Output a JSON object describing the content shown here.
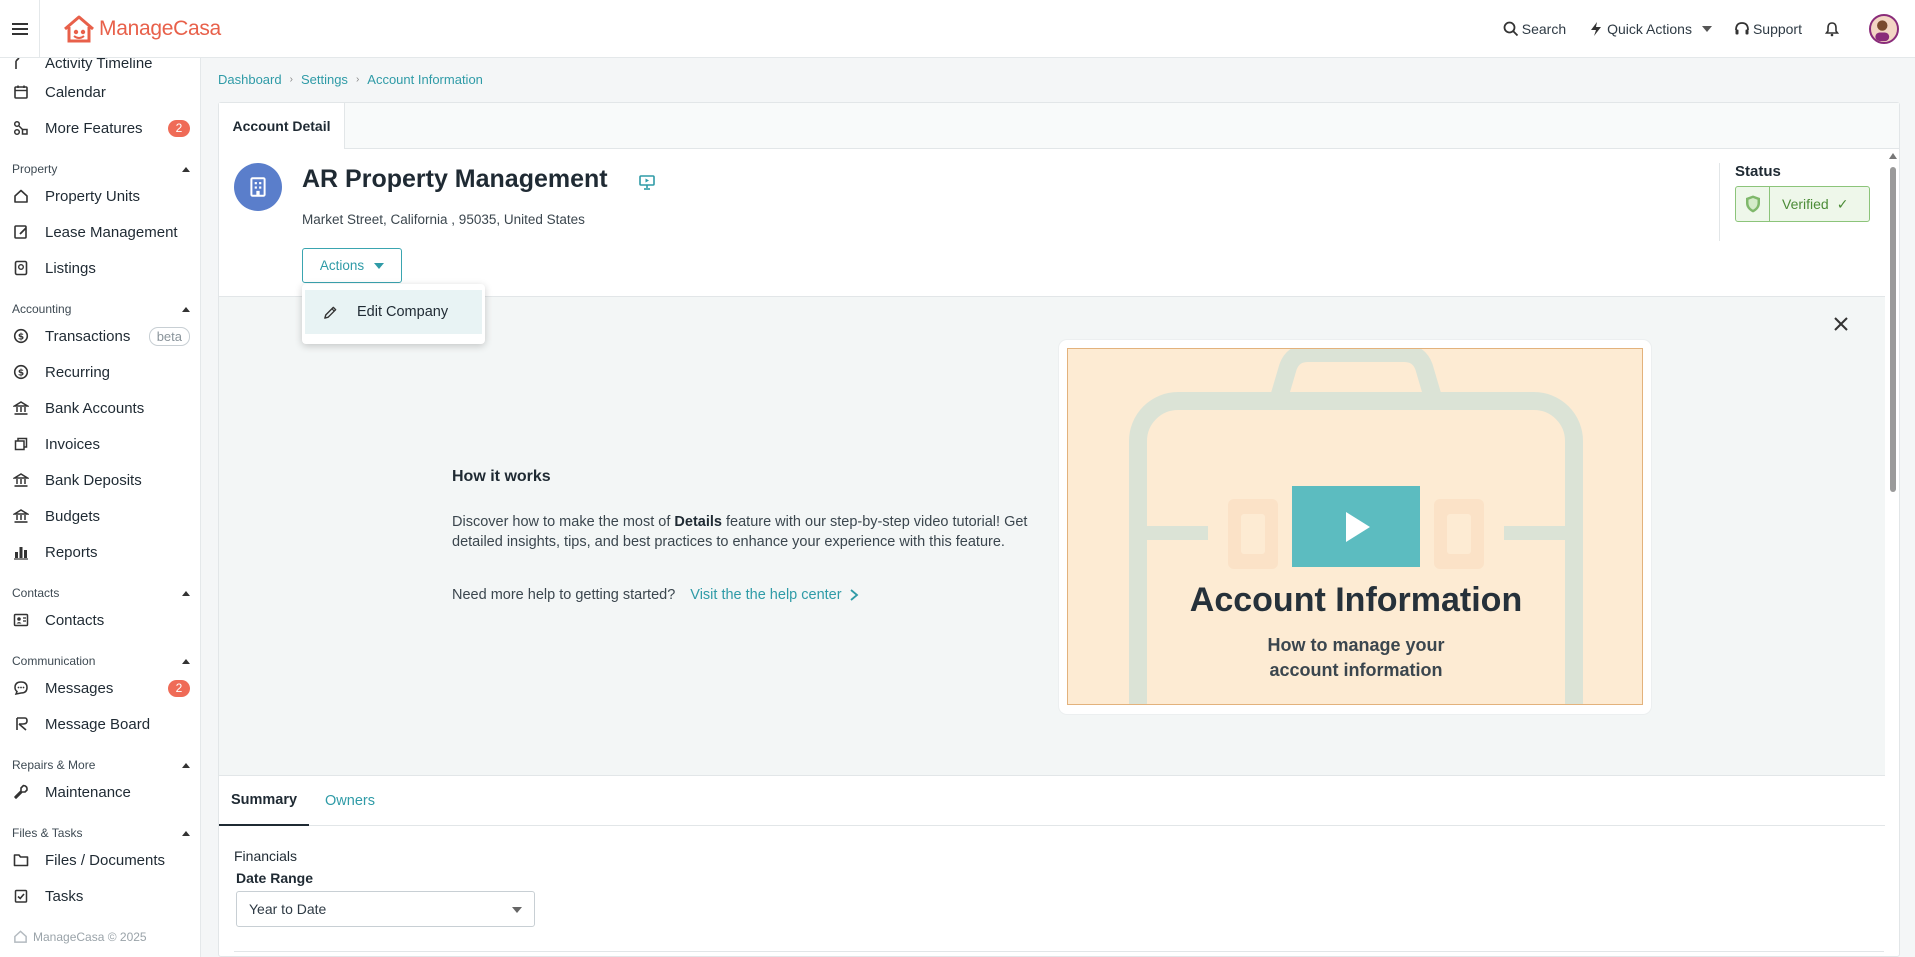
{
  "app": {
    "logo_manage": "Manage",
    "logo_casa": "Casa"
  },
  "topbar": {
    "search_label": "Search",
    "quick_actions_label": "Quick Actions",
    "support_label": "Support"
  },
  "sidebar": {
    "partial_top_label": "Activity Timeline",
    "items": [
      {
        "label": "Calendar",
        "icon": "calendar-icon"
      },
      {
        "label": "More Features",
        "icon": "features-icon",
        "badge": "2"
      },
      {
        "label": "Property Units",
        "icon": "home-icon"
      },
      {
        "label": "Lease Management",
        "icon": "edit-doc-icon"
      },
      {
        "label": "Listings",
        "icon": "listing-icon"
      },
      {
        "label": "Transactions",
        "icon": "dollar-icon",
        "tag": "beta"
      },
      {
        "label": "Recurring",
        "icon": "dollar-icon"
      },
      {
        "label": "Bank Accounts",
        "icon": "bank-icon"
      },
      {
        "label": "Invoices",
        "icon": "invoice-icon"
      },
      {
        "label": "Bank Deposits",
        "icon": "bank-icon"
      },
      {
        "label": "Budgets",
        "icon": "bank-icon"
      },
      {
        "label": "Reports",
        "icon": "chart-icon"
      },
      {
        "label": "Contacts",
        "icon": "contact-card-icon"
      },
      {
        "label": "Messages",
        "icon": "chat-icon",
        "badge": "2"
      },
      {
        "label": "Message Board",
        "icon": "board-icon"
      },
      {
        "label": "Maintenance",
        "icon": "wrench-icon"
      },
      {
        "label": "Files / Documents",
        "icon": "folder-icon"
      },
      {
        "label": "Tasks",
        "icon": "checkbox-icon"
      }
    ],
    "sections": {
      "property": "Property",
      "accounting": "Accounting",
      "contacts": "Contacts",
      "communication": "Communication",
      "repairs": "Repairs & More",
      "files": "Files & Tasks"
    },
    "footer": "ManageCasa © 2025"
  },
  "breadcrumb": [
    "Dashboard",
    "Settings",
    "Account Information"
  ],
  "main": {
    "tab_label": "Account Detail",
    "company_name": "AR Property Management",
    "address": "Market Street, California , 95035, United States",
    "actions_label": "Actions",
    "status_label": "Status",
    "status_value": "Verified",
    "status_check": "✓"
  },
  "dropdown": {
    "edit_company_label": "Edit Company"
  },
  "info_panel": {
    "title": "How it works",
    "desc_pre": "Discover how to make the most of ",
    "desc_bold": "Details",
    "desc_post": " feature with our step-by-step video tutorial! Get detailed insights, tips, and best practices to enhance your experience with this feature.",
    "help_prompt": "Need more help to getting started?",
    "help_link": "Visit the the help center",
    "video_title": "Account Information",
    "video_sub_line1": "How to manage your",
    "video_sub_line2": "account information"
  },
  "subtabs": {
    "summary": "Summary",
    "owners": "Owners"
  },
  "financials": {
    "label": "Financials",
    "date_range_label": "Date Range",
    "date_range_value": "Year to Date"
  },
  "colors": {
    "brand": "#e8604a",
    "accent": "#2f9ba7",
    "badge": "#ef6b57",
    "verified": "#4c8c38"
  }
}
